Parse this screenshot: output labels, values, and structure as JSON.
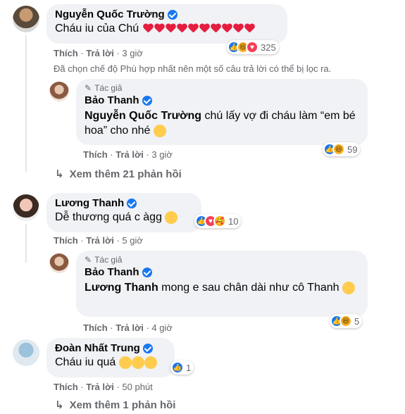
{
  "comments": [
    {
      "name": "Nguyễn Quốc Trường",
      "text": "Cháu iu của Chú",
      "hearts": 10,
      "like_label": "Thích",
      "reply_label": "Trả lời",
      "time": "3 giờ",
      "reaction_count": "325",
      "reactions": [
        "like-icon",
        "haha-icon",
        "love-icon"
      ]
    },
    {
      "author_tag": "Tác giả",
      "name": "Bảo Thanh",
      "mention": "Nguyễn Quốc Trường",
      "text": " chú lấy vợ đi cháu làm “em bé hoa” cho nhé",
      "like_label": "Thích",
      "reply_label": "Trả lời",
      "time": "3 giờ",
      "reaction_count": "59",
      "reactions": [
        "like-icon",
        "haha-icon"
      ]
    },
    {
      "name": "Lương Thanh",
      "text": "Dễ thương quá c àgg",
      "like_label": "Thích",
      "reply_label": "Trả lời",
      "time": "5 giờ",
      "reaction_count": "10",
      "reactions": [
        "like-icon",
        "love-icon",
        "care-icon"
      ]
    },
    {
      "author_tag": "Tác giả",
      "name": "Bảo Thanh",
      "mention": "Lương Thanh",
      "text": " mong e sau chân dài như cô Thanh",
      "like_label": "Thích",
      "reply_label": "Trả lời",
      "time": "4 giờ",
      "reaction_count": "5",
      "reactions": [
        "like-icon",
        "haha-icon"
      ]
    },
    {
      "name": "Đoàn Nhất Trung",
      "text": "Cháu iu quá",
      "like_label": "Thích",
      "reply_label": "Trả lời",
      "time": "50 phút",
      "reaction_count": "1",
      "reactions": [
        "like-icon"
      ]
    }
  ],
  "filter_notice": "Đã chọn chế độ Phù hợp nhất nên một số câu trả lời có thể bị lọc ra.",
  "more_replies_1": "Xem thêm 21 phản hồi",
  "more_replies_2": "Xem thêm 1 phản hồi",
  "colors": {
    "bubble": "#f0f2f5",
    "muted": "#65676b",
    "verified": "#1877f2",
    "heart": "#e41e3f"
  }
}
